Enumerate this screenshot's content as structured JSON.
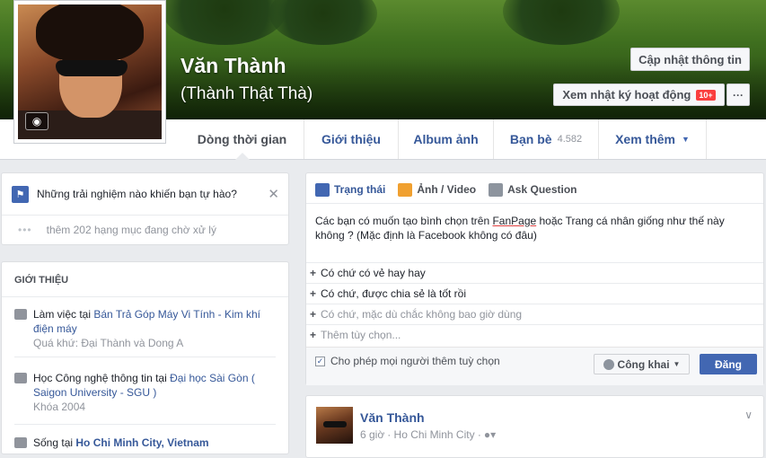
{
  "profile": {
    "name": "Văn Thành",
    "nickname": "(Thành Thật Thà)",
    "update_info_label": "Cập nhật thông tin",
    "activity_log_label": "Xem nhật ký hoạt động",
    "activity_log_badge": "10+",
    "more_label": "···"
  },
  "nav": {
    "tabs": [
      {
        "label": "Dòng thời gian"
      },
      {
        "label": "Giới thiệu"
      },
      {
        "label": "Album ảnh"
      },
      {
        "label": "Bạn bè",
        "count": "4.582"
      },
      {
        "label": "Xem thêm"
      }
    ]
  },
  "question_card": {
    "question": "Những trải nghiệm nào khiến bạn tự hào?",
    "pending_dots": "•••",
    "pending_text": "thêm 202 hạng mục đang chờ xử lý"
  },
  "intro": {
    "title": "GIỚI THIỆU",
    "work_prefix": "Làm việc tại ",
    "work_place": "Bán Trả Góp Máy Vi Tính - Kim khí điện máy",
    "work_past": "Quá khứ: Đại Thành và Dong A",
    "study_prefix": "Học Công nghệ thông tin tại ",
    "study_place": "Đại học Sài Gòn ( Saigon University - SGU )",
    "study_year": "Khóa 2004",
    "lives_prefix": "Sống tại ",
    "lives_place": "Ho Chi Minh City, Vietnam"
  },
  "composer": {
    "tabs": [
      "Trạng thái",
      "Ảnh / Video",
      "Ask Question"
    ],
    "question_before": "Các bạn có muốn tạo bình chọn trên ",
    "question_underlined": "FanPage",
    "question_after": " hoặc Trang cá nhân giống như thế này không ? (Mặc định là Facebook không có đâu)",
    "options": [
      "Có chứ có vẻ hay hay",
      "Có chứ, được chia sẻ là tốt rồi",
      "Có chứ, mặc dù chắc không bao giờ dùng",
      "Thêm tùy chọn..."
    ],
    "allow_label": "Cho phép mọi người thêm tuỳ chọn",
    "privacy_label": "Công khai",
    "post_label": "Đăng"
  },
  "post": {
    "author": "Văn Thành",
    "time": "6 giờ",
    "location": "· Ho Chi Minh City ·"
  },
  "colors": {
    "accent": "#4267b2",
    "link": "#365899",
    "badge": "#fa3e3e"
  }
}
